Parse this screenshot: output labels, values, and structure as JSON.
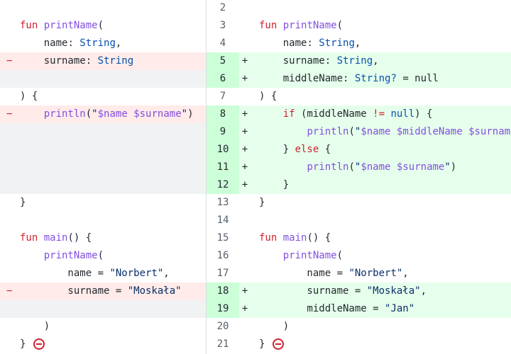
{
  "left_rows": [
    {
      "type": "blank",
      "marker": "",
      "code": ""
    },
    {
      "type": "ctx",
      "marker": "",
      "tokens": [
        [
          "kw",
          "fun"
        ],
        [
          "pl",
          " "
        ],
        [
          "fn",
          "printName"
        ],
        [
          "pl",
          "("
        ]
      ]
    },
    {
      "type": "ctx",
      "marker": "",
      "tokens": [
        [
          "pl",
          "    name"
        ],
        [
          "pl",
          ": "
        ],
        [
          "ty",
          "String"
        ],
        [
          "pl",
          ","
        ]
      ]
    },
    {
      "type": "del",
      "marker": "−",
      "tokens": [
        [
          "pl",
          "    surname"
        ],
        [
          "pl",
          ": "
        ],
        [
          "ty",
          "String"
        ]
      ]
    },
    {
      "type": "empty",
      "marker": "",
      "tokens": []
    },
    {
      "type": "ctx",
      "marker": "",
      "tokens": [
        [
          "pl",
          ") {"
        ]
      ]
    },
    {
      "type": "del",
      "marker": "−",
      "tokens": [
        [
          "pl",
          "    "
        ],
        [
          "fn",
          "println"
        ],
        [
          "pl",
          "("
        ],
        [
          "str",
          "\""
        ],
        [
          "tmpl",
          "$name"
        ],
        [
          "str",
          " "
        ],
        [
          "tmpl",
          "$surname"
        ],
        [
          "str",
          "\""
        ],
        [
          "pl",
          ")"
        ]
      ]
    },
    {
      "type": "empty",
      "marker": "",
      "tokens": []
    },
    {
      "type": "empty",
      "marker": "",
      "tokens": []
    },
    {
      "type": "empty",
      "marker": "",
      "tokens": []
    },
    {
      "type": "empty",
      "marker": "",
      "tokens": []
    },
    {
      "type": "ctx",
      "marker": "",
      "tokens": [
        [
          "pl",
          "}"
        ]
      ]
    },
    {
      "type": "blank",
      "marker": "",
      "tokens": []
    },
    {
      "type": "ctx",
      "marker": "",
      "tokens": [
        [
          "kw",
          "fun"
        ],
        [
          "pl",
          " "
        ],
        [
          "fn",
          "main"
        ],
        [
          "pl",
          "() {"
        ]
      ]
    },
    {
      "type": "ctx",
      "marker": "",
      "tokens": [
        [
          "pl",
          "    "
        ],
        [
          "fn",
          "printName"
        ],
        [
          "pl",
          "("
        ]
      ]
    },
    {
      "type": "ctx",
      "marker": "",
      "tokens": [
        [
          "pl",
          "        name = "
        ],
        [
          "str",
          "\"Norbert\""
        ],
        [
          "pl",
          ","
        ]
      ]
    },
    {
      "type": "del",
      "marker": "−",
      "tokens": [
        [
          "pl",
          "        surname = "
        ],
        [
          "str",
          "\"Moskała\""
        ]
      ]
    },
    {
      "type": "empty",
      "marker": "",
      "tokens": []
    },
    {
      "type": "ctx",
      "marker": "",
      "tokens": [
        [
          "pl",
          "    )"
        ]
      ]
    },
    {
      "type": "ctx",
      "marker": "",
      "tokens": [
        [
          "pl",
          "} "
        ]
      ],
      "icon": true
    }
  ],
  "right_rows": [
    {
      "type": "ctx",
      "num": "2",
      "marker": "",
      "tokens": []
    },
    {
      "type": "ctx",
      "num": "3",
      "marker": "",
      "tokens": [
        [
          "kw",
          "fun"
        ],
        [
          "pl",
          " "
        ],
        [
          "fn",
          "printName"
        ],
        [
          "pl",
          "("
        ]
      ]
    },
    {
      "type": "ctx",
      "num": "4",
      "marker": "",
      "tokens": [
        [
          "pl",
          "    name"
        ],
        [
          "pl",
          ": "
        ],
        [
          "ty",
          "String"
        ],
        [
          "pl",
          ","
        ]
      ]
    },
    {
      "type": "add",
      "num": "5",
      "marker": "+",
      "tokens": [
        [
          "pl",
          "    surname"
        ],
        [
          "pl",
          ": "
        ],
        [
          "ty",
          "String"
        ],
        [
          "pl",
          ","
        ]
      ]
    },
    {
      "type": "add",
      "num": "6",
      "marker": "+",
      "tokens": [
        [
          "pl",
          "    middleName"
        ],
        [
          "pl",
          ": "
        ],
        [
          "ty",
          "String?"
        ],
        [
          "pl",
          " = null"
        ]
      ]
    },
    {
      "type": "ctx",
      "num": "7",
      "marker": "",
      "tokens": [
        [
          "pl",
          ") {"
        ]
      ]
    },
    {
      "type": "add",
      "num": "8",
      "marker": "+",
      "tokens": [
        [
          "pl",
          "    "
        ],
        [
          "kw",
          "if"
        ],
        [
          "pl",
          " (middleName "
        ],
        [
          "kw",
          "!="
        ],
        [
          "pl",
          " "
        ],
        [
          "ty",
          "null"
        ],
        [
          "pl",
          ") {"
        ]
      ]
    },
    {
      "type": "add",
      "num": "9",
      "marker": "+",
      "tokens": [
        [
          "pl",
          "        "
        ],
        [
          "fn",
          "println"
        ],
        [
          "pl",
          "("
        ],
        [
          "str",
          "\""
        ],
        [
          "tmpl",
          "$name"
        ],
        [
          "str",
          " "
        ],
        [
          "tmpl",
          "$middleName"
        ],
        [
          "str",
          " "
        ],
        [
          "tmpl",
          "$surname"
        ],
        [
          "str",
          "\""
        ],
        [
          "pl",
          ")"
        ]
      ]
    },
    {
      "type": "add",
      "num": "10",
      "marker": "+",
      "tokens": [
        [
          "pl",
          "    } "
        ],
        [
          "kw",
          "else"
        ],
        [
          "pl",
          " {"
        ]
      ]
    },
    {
      "type": "add",
      "num": "11",
      "marker": "+",
      "tokens": [
        [
          "pl",
          "        "
        ],
        [
          "fn",
          "println"
        ],
        [
          "pl",
          "("
        ],
        [
          "str",
          "\""
        ],
        [
          "tmpl",
          "$name"
        ],
        [
          "str",
          " "
        ],
        [
          "tmpl",
          "$surname"
        ],
        [
          "str",
          "\""
        ],
        [
          "pl",
          ")"
        ]
      ]
    },
    {
      "type": "add",
      "num": "12",
      "marker": "+",
      "tokens": [
        [
          "pl",
          "    }"
        ]
      ]
    },
    {
      "type": "ctx",
      "num": "13",
      "marker": "",
      "tokens": [
        [
          "pl",
          "}"
        ]
      ]
    },
    {
      "type": "ctx",
      "num": "14",
      "marker": "",
      "tokens": []
    },
    {
      "type": "ctx",
      "num": "15",
      "marker": "",
      "tokens": [
        [
          "kw",
          "fun"
        ],
        [
          "pl",
          " "
        ],
        [
          "fn",
          "main"
        ],
        [
          "pl",
          "() {"
        ]
      ]
    },
    {
      "type": "ctx",
      "num": "16",
      "marker": "",
      "tokens": [
        [
          "pl",
          "    "
        ],
        [
          "fn",
          "printName"
        ],
        [
          "pl",
          "("
        ]
      ]
    },
    {
      "type": "ctx",
      "num": "17",
      "marker": "",
      "tokens": [
        [
          "pl",
          "        name = "
        ],
        [
          "str",
          "\"Norbert\""
        ],
        [
          "pl",
          ","
        ]
      ]
    },
    {
      "type": "add",
      "num": "18",
      "marker": "+",
      "tokens": [
        [
          "pl",
          "        surname = "
        ],
        [
          "str",
          "\"Moskała\""
        ],
        [
          "pl",
          ","
        ]
      ]
    },
    {
      "type": "add",
      "num": "19",
      "marker": "+",
      "tokens": [
        [
          "pl",
          "        middleName = "
        ],
        [
          "str",
          "\"Jan\""
        ]
      ]
    },
    {
      "type": "ctx",
      "num": "20",
      "marker": "",
      "tokens": [
        [
          "pl",
          "    )"
        ]
      ]
    },
    {
      "type": "ctx",
      "num": "21",
      "marker": "",
      "tokens": [
        [
          "pl",
          "} "
        ]
      ],
      "icon": true
    }
  ],
  "colors": {
    "deletion_bg": "#ffebe9",
    "addition_bg": "#e6ffec",
    "addition_gutter_bg": "#ccffd8",
    "empty_bg": "#f0f2f4",
    "keyword": "#cf222e",
    "type": "#0550ae",
    "string": "#0a3069",
    "template": "#8250df"
  },
  "icons": {
    "no_newline": "no-newline-icon"
  }
}
